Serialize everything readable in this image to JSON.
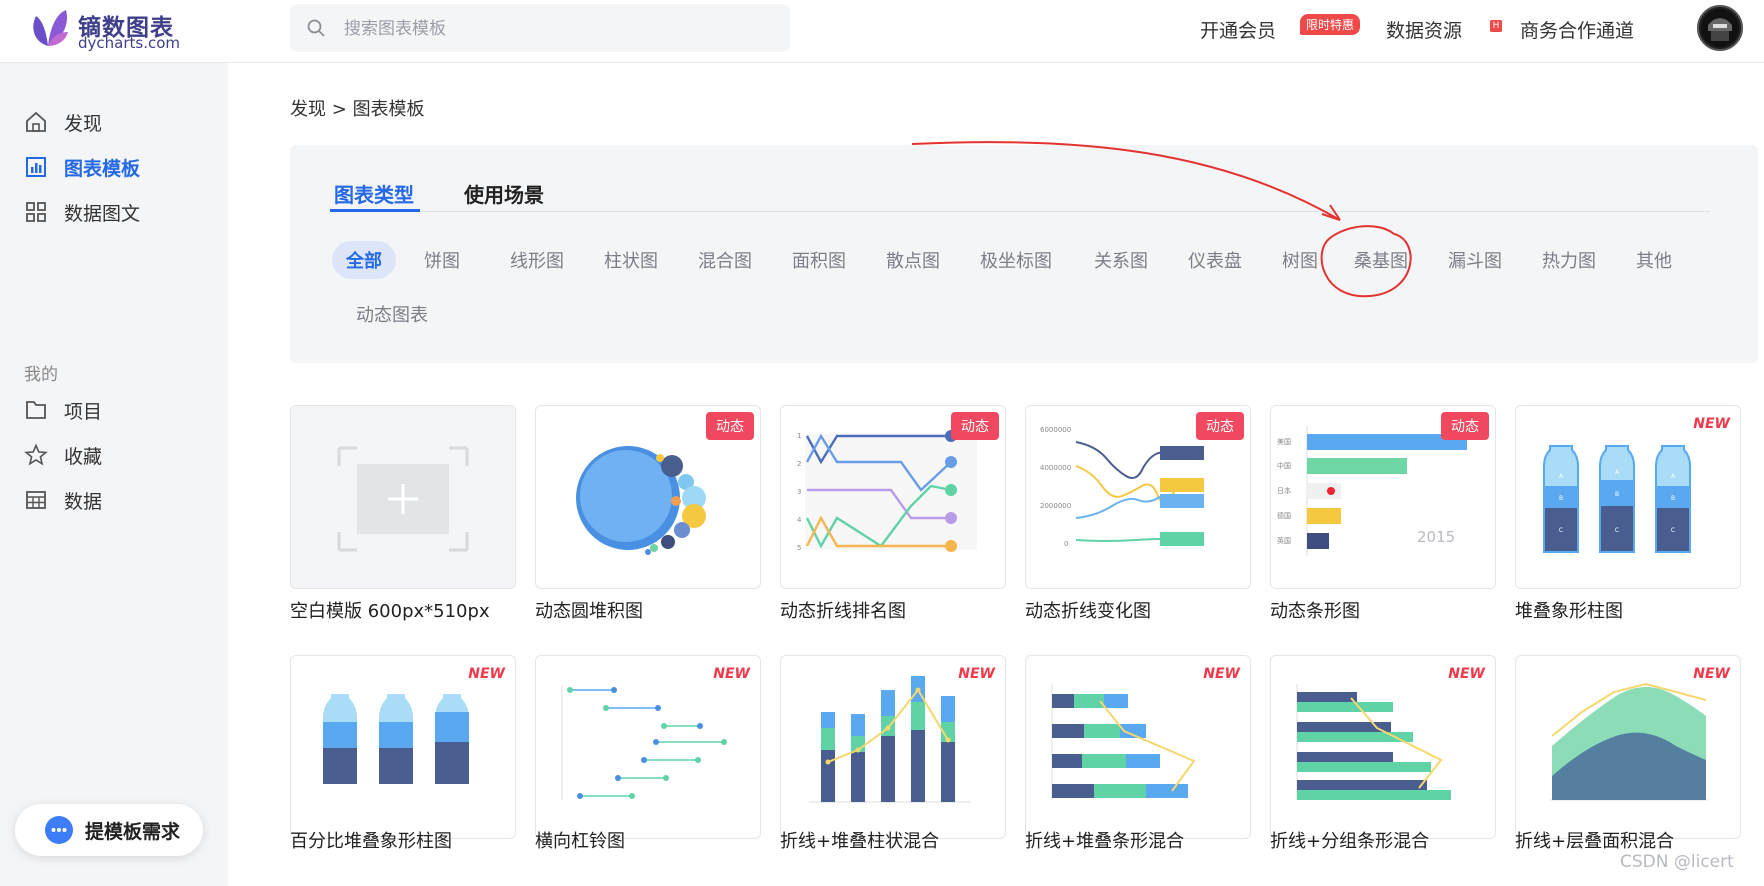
{
  "brand": {
    "title": "镝数图表",
    "subtitle": "dycharts.com"
  },
  "search": {
    "placeholder": "搜索图表模板"
  },
  "topnav": {
    "member": "开通会员",
    "member_badge": "限时特惠",
    "resources": "数据资源",
    "resources_badge": "H",
    "cooperation": "商务合作通道"
  },
  "sidebar": {
    "items": [
      {
        "label": "发现",
        "icon": "home-icon"
      },
      {
        "label": "图表模板",
        "icon": "chart-template-icon"
      },
      {
        "label": "数据图文",
        "icon": "grid-icon"
      }
    ],
    "group_label": "我的",
    "my_items": [
      {
        "label": "项目",
        "icon": "folder-icon"
      },
      {
        "label": "收藏",
        "icon": "star-icon"
      },
      {
        "label": "数据",
        "icon": "table-icon"
      }
    ],
    "feedback": "提模板需求"
  },
  "breadcrumb": {
    "root": "发现",
    "sep": ">",
    "current": "图表模板"
  },
  "filters": {
    "tabs": [
      "图表类型",
      "使用场景"
    ],
    "types": [
      "全部",
      "饼图",
      "线形图",
      "柱状图",
      "混合图",
      "面积图",
      "散点图",
      "极坐标图",
      "关系图",
      "仪表盘",
      "树图",
      "桑基图",
      "漏斗图",
      "热力图",
      "其他",
      "动态图表"
    ]
  },
  "tags": {
    "dynamic": "动态",
    "new": "NEW"
  },
  "templates": [
    {
      "title": "空白模版 600px*510px",
      "tag": ""
    },
    {
      "title": "动态圆堆积图",
      "tag": "dynamic"
    },
    {
      "title": "动态折线排名图",
      "tag": "dynamic"
    },
    {
      "title": "动态折线变化图",
      "tag": "dynamic"
    },
    {
      "title": "动态条形图",
      "tag": "dynamic"
    },
    {
      "title": "堆叠象形柱图",
      "tag": "new"
    },
    {
      "title": "百分比堆叠象形柱图",
      "tag": "new"
    },
    {
      "title": "横向杠铃图",
      "tag": "new"
    },
    {
      "title": "折线+堆叠柱状混合",
      "tag": "new"
    },
    {
      "title": "折线+堆叠条形混合",
      "tag": "new"
    },
    {
      "title": "折线+分组条形混合",
      "tag": "new"
    },
    {
      "title": "折线+层叠面积混合",
      "tag": "new"
    }
  ],
  "thumb_text": {
    "bar_year": "2015",
    "bottle_labels": [
      "A",
      "B",
      "C"
    ],
    "line_axis": [
      "6000000",
      "4000000",
      "2000000",
      "0"
    ],
    "bar_countries": [
      "美国",
      "中国",
      "日本",
      "德国",
      "英国"
    ]
  },
  "watermark": "CSDN @licert"
}
